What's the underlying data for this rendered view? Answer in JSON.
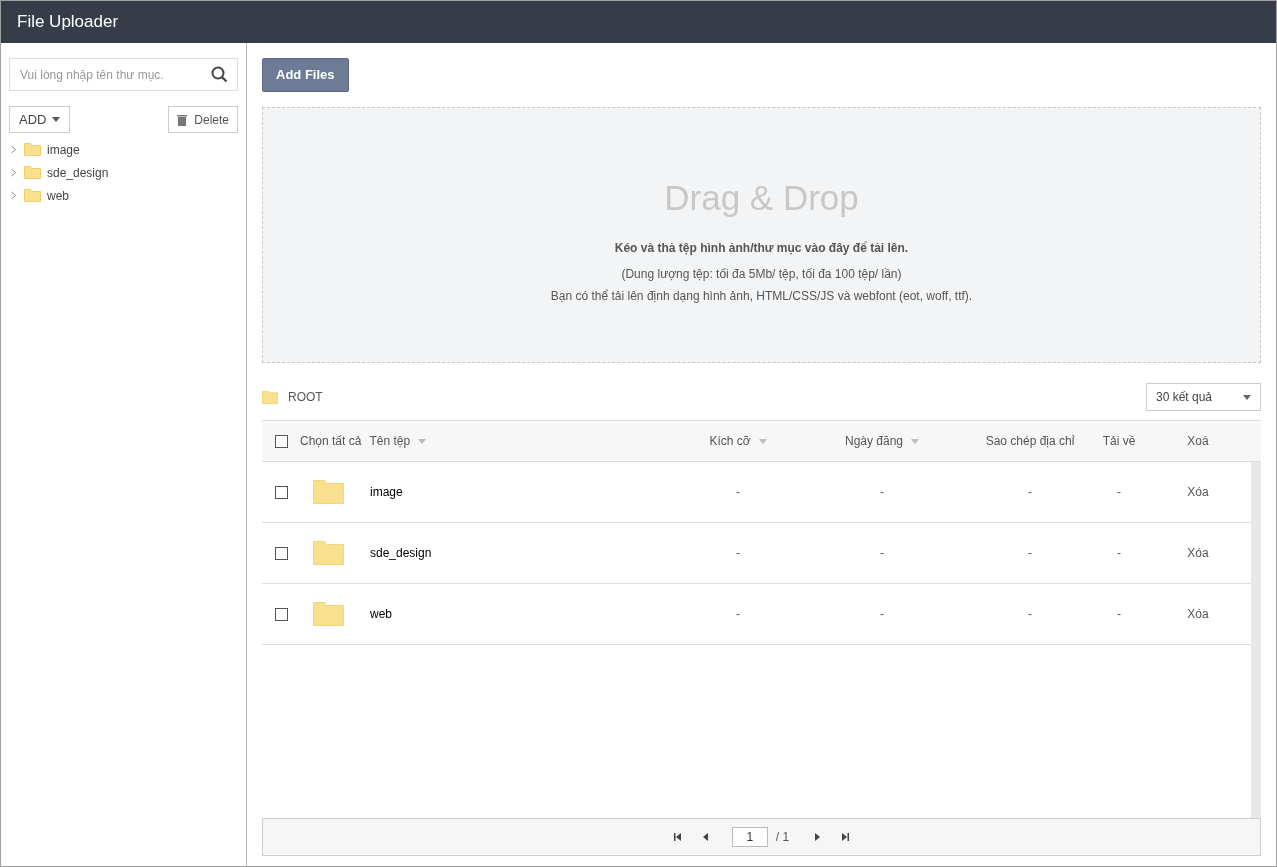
{
  "window": {
    "title": "File Uploader"
  },
  "sidebar": {
    "search": {
      "placeholder": "Vui lòng nhập tên thư mục."
    },
    "add_button": "ADD",
    "delete_button": "Delete",
    "tree": [
      {
        "label": "image",
        "expanded": false
      },
      {
        "label": "sde_design",
        "expanded": false
      },
      {
        "label": "web",
        "expanded": false
      }
    ]
  },
  "toolbar": {
    "add_files": "Add Files"
  },
  "dropzone": {
    "title": "Drag & Drop",
    "instruction": "Kéo và thả tệp hình ảnh/thư mục vào đây để tải lên.",
    "limits": "(Dung lượng tệp: tối đa 5Mb/ tệp, tối đa 100 tệp/ lần)",
    "formats": "Bạn có thể tải lên định dạng hình ảnh, HTML/CSS/JS và webfont (eot, woff, ttf)."
  },
  "breadcrumb": "ROOT",
  "page_size": "30 kết quả",
  "table": {
    "select_all": {
      "label": "Chọn tất cả",
      "checked": false
    },
    "columns": [
      {
        "label": "Tên tệp",
        "sortable": true
      },
      {
        "label": "Kích cỡ",
        "sortable": true
      },
      {
        "label": "Ngày đăng",
        "sortable": true
      },
      {
        "label": "Sao chép địa chỉ",
        "sortable": false
      },
      {
        "label": "Tải về",
        "sortable": false
      },
      {
        "label": "Xoá",
        "sortable": false
      }
    ],
    "rows": [
      {
        "checked": false,
        "name": "image",
        "size": "-",
        "date": "-",
        "copy": "-",
        "download": "-",
        "delete": "Xóa"
      },
      {
        "checked": false,
        "name": "sde_design",
        "size": "-",
        "date": "-",
        "copy": "-",
        "download": "-",
        "delete": "Xóa"
      },
      {
        "checked": false,
        "name": "web",
        "size": "-",
        "date": "-",
        "copy": "-",
        "download": "-",
        "delete": "Xóa"
      }
    ]
  },
  "pagination": {
    "page": "1",
    "total": "/ 1"
  }
}
